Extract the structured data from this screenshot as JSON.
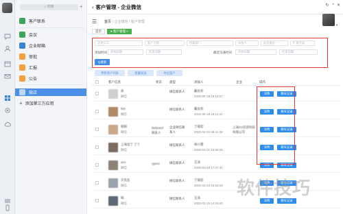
{
  "sidebar": {
    "search_placeholder": "搜索",
    "plus_icon": "plus-icon",
    "top_item": {
      "label": "客户联系",
      "color": "#3ba55c"
    },
    "items": [
      {
        "label": "会议",
        "color": "#3ba55c"
      },
      {
        "label": "企业邮箱",
        "color": "#3b82d6"
      },
      {
        "label": "审批",
        "color": "#f2a33a"
      },
      {
        "label": "汇报",
        "color": "#f2a33a"
      },
      {
        "label": "公告",
        "color": "#f2a33a"
      }
    ],
    "active_item": {
      "label": "微店",
      "color": "#4b8fe6"
    },
    "add_app": "添加第三方应用"
  },
  "header": {
    "title": "客户管理 - 企业微信",
    "back_icon": "chevron-left-icon"
  },
  "toolbar": {
    "menu_icon": "hamburger-icon",
    "breadcrumb": [
      "首页",
      "/ 企业微信",
      "/ 客户管理"
    ]
  },
  "tabs": [
    {
      "label": "首页",
      "active": false
    },
    {
      "label": "● 客户管理 ×",
      "active": true
    }
  ],
  "filter": {
    "row1": [
      "选择员工",
      "客户名称",
      "所属部门",
      "添加人",
      "标签类型",
      "扩展字段"
    ],
    "row2_labels": [
      "添加时间",
      "最近沟通时间"
    ],
    "date_placeholders": [
      "开始日期",
      "结束日期",
      "开始日期",
      "结束日期"
    ],
    "query_button": "Q搜索"
  },
  "actions": [
    "更新客户列表",
    "批量发送",
    "导出客户"
  ],
  "table": {
    "headers": [
      "客户信息",
      "状态",
      "类型",
      "添加人",
      "企业",
      "操作"
    ],
    "rows": [
      {
        "name": "安",
        "sub": "微信",
        "status": "",
        "type": "微信联系人",
        "adder": "戴女彤",
        "time": "2020-05-19 18:19:27",
        "company": "",
        "thumb": "#cfcfcf"
      },
      {
        "name": "fish",
        "sub": "微信",
        "status": "",
        "type": "微信联系人",
        "adder": "戴女彤",
        "time": "2020-05-19 18:11:31",
        "company": "",
        "thumb": "#b08a68"
      },
      {
        "name": "明明",
        "sub": "微信",
        "status": "Bebeard 联系人",
        "type": "企业微信联系人",
        "adder": "丁锡宏",
        "time": "2020-04-02 08:41:38",
        "company": "上海XX信息科技有限公司",
        "thumb": "#c9a88c"
      },
      {
        "name": "上海宝丁 丁了",
        "sub": "微信",
        "status": "",
        "type": "微信联系人",
        "adder": "杨小慧",
        "time": "2020-03-21 15:05:25",
        "company": "",
        "thumb": "#7d6a60"
      },
      {
        "name": "ann",
        "sub": "微信",
        "status": "rganiz",
        "type": "微信联系人",
        "adder": "王涛",
        "time": "2020-03-20 17:07:41",
        "company": "",
        "thumb": "#8e8176"
      },
      {
        "name": "方先生",
        "sub": "微信",
        "status": "",
        "type": "微信联系人",
        "adder": "丁锡宏",
        "time": "2020-03-23 15:03:28",
        "company": "",
        "thumb": "#9aa3ad"
      },
      {
        "name": "明",
        "sub": "微信",
        "status": "",
        "type": "微信联系人",
        "adder": "王涛",
        "time": "2020-03-19 14:19:40",
        "company": "",
        "thumb": "#5d6a75"
      }
    ],
    "op_detail": "详情",
    "op_chat": "聊天记录"
  },
  "watermark": "软件技巧"
}
